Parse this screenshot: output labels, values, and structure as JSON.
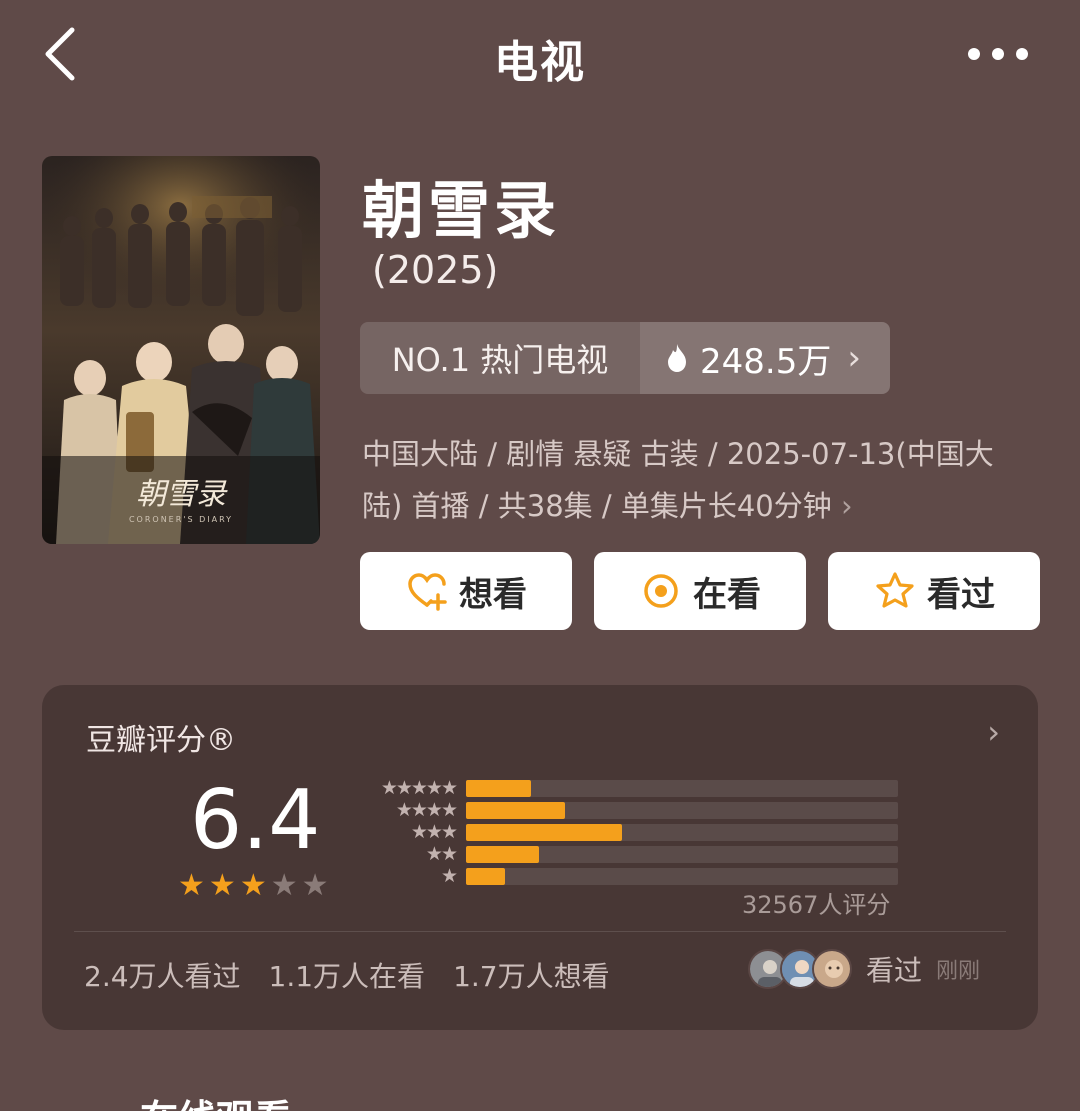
{
  "header": {
    "title": "电视"
  },
  "show": {
    "title": "朝雪录",
    "year": "(2025)",
    "rank_label": "NO.1 热门电视",
    "heat": "248.5万",
    "meta_line1": "中国大陆 / 剧情 悬疑 古装 / 2025-07-13(中国大",
    "meta_line2": "陆) 首播 / 共38集 / 单集片长40分钟",
    "poster_title": "朝雪录",
    "poster_subtitle": "CORONER'S DIARY"
  },
  "actions": {
    "want": "想看",
    "watching": "在看",
    "watched": "看过"
  },
  "rating": {
    "label": "豆瓣评分®",
    "score": "6.4",
    "score_value": 6.4,
    "stars_filled": 3,
    "stars_total": 5,
    "count_text": "32567人评分",
    "distribution": [
      {
        "stars": "★★★★★",
        "percent": 15
      },
      {
        "stars": "★★★★",
        "percent": 23
      },
      {
        "stars": "★★★",
        "percent": 36
      },
      {
        "stars": "★★",
        "percent": 17
      },
      {
        "stars": "★",
        "percent": 9
      }
    ],
    "stats": {
      "watched": "2.4万人看过",
      "watching": "1.1万人在看",
      "want": "1.7万人想看"
    },
    "friends_label": "看过",
    "friends_time": "刚刚"
  },
  "section": {
    "online_title": "在线观看"
  },
  "colors": {
    "background": "#5f4a48",
    "accent": "#f4a01c",
    "star_empty": "#8a7b78"
  }
}
